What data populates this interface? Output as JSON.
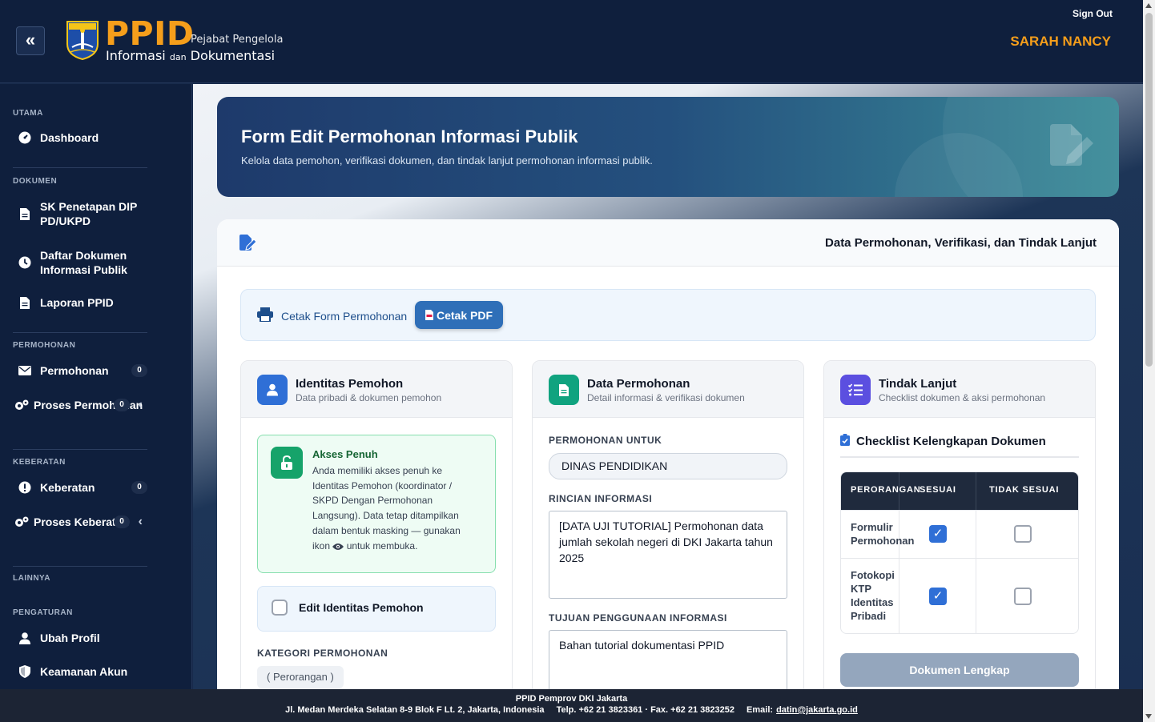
{
  "header": {
    "logo_text": "PPID",
    "logo_sub1": "Pejabat Pengelola",
    "logo_sub2a": "Informasi",
    "logo_sub2b": "dan",
    "logo_sub2c": "Dokumentasi",
    "signout_label": "Sign Out",
    "username": "SARAH NANCY"
  },
  "sidebar": {
    "sections": {
      "utama": "UTAMA",
      "dokumen": "DOKUMEN",
      "permohonan": "PERMOHONAN",
      "keberatan": "KEBERATAN",
      "lainnya": "LAINNYA",
      "pengaturan": "PENGATURAN"
    },
    "items": {
      "dashboard": "Dashboard",
      "sk_penetapan": "SK Penetapan DIP PD/UKPD",
      "daftar_dokumen": "Daftar Dokumen Informasi Publik",
      "laporan": "Laporan PPID",
      "permohonan": "Permohonan",
      "permohonan_count": "0",
      "proses_permohonan": "Proses Permohonan",
      "proses_permohonan_count": "0",
      "keberatan": "Keberatan",
      "keberatan_count": "0",
      "proses_keberatan": "Proses Keberatan",
      "proses_keberatan_count": "0",
      "ubah_profil": "Ubah Profil",
      "keamanan_akun": "Keamanan Akun"
    }
  },
  "hero": {
    "title": "Form Edit Permohonan Informasi Publik",
    "subtitle": "Kelola data pemohon, verifikasi dokumen, dan tindak lanjut permohonan informasi publik."
  },
  "card": {
    "title": "Data Permohonan, Verifikasi, dan Tindak Lanjut",
    "print_label": "Cetak Form Permohonan",
    "pdf_label": "Cetak PDF"
  },
  "identitas": {
    "title": "Identitas Pemohon",
    "subtitle": "Data pribadi & dokumen pemohon",
    "access_title": "Akses Penuh",
    "access_text_1": "Anda memiliki akses penuh ke Identitas Pemohon (koordinator / SKPD Dengan Permohonan Langsung). Data tetap ditampilkan dalam bentuk masking — gunakan ikon",
    "access_text_2": "untuk membuka.",
    "edit_label": "Edit Identitas Pemohon",
    "kategori_label": "KATEGORI PERMOHONAN",
    "kategori_value": "( Perorangan )"
  },
  "data_permohonan": {
    "title": "Data Permohonan",
    "subtitle": "Detail informasi & verifikasi dokumen",
    "untuk_label": "PERMOHONAN UNTUK",
    "untuk_value": "DINAS PENDIDIKAN",
    "rincian_label": "RINCIAN INFORMASI",
    "rincian_value": "[DATA UJI TUTORIAL] Permohonan data jumlah sekolah negeri di DKI Jakarta tahun 2025",
    "tujuan_label": "TUJUAN PENGGUNAAN INFORMASI",
    "tujuan_value": "Bahan tutorial dokumentasi PPID"
  },
  "tindak_lanjut": {
    "title": "Tindak Lanjut",
    "subtitle": "Checklist dokumen & aksi permohonan",
    "checklist_title": "Checklist Kelengkapan Dokumen",
    "col_1": "PERORANGAN",
    "col_2": "SESUAI",
    "col_3": "TIDAK SESUAI",
    "rows": [
      {
        "label": "Formulir Permohonan",
        "sesuai": true,
        "tidak_sesuai": false
      },
      {
        "label": "Fotokopi KTP Identitas Pribadi",
        "sesuai": true,
        "tidak_sesuai": false
      }
    ],
    "button_label": "Dokumen Lengkap"
  },
  "footer": {
    "title": "PPID Pemprov DKI Jakarta",
    "address": "Jl. Medan Merdeka Selatan 8-9 Blok F Lt. 2, Jakarta, Indonesia",
    "phone": "Telp. +62 21 3823361 · Fax. +62 21 3823252",
    "email_label": "Email:",
    "email": "datin@jakarta.go.id"
  },
  "colors": {
    "brand_orange": "#f59e1b",
    "navy": "#0f1f3d",
    "primary_blue": "#2f6fb8",
    "success_green": "#16a36a"
  }
}
